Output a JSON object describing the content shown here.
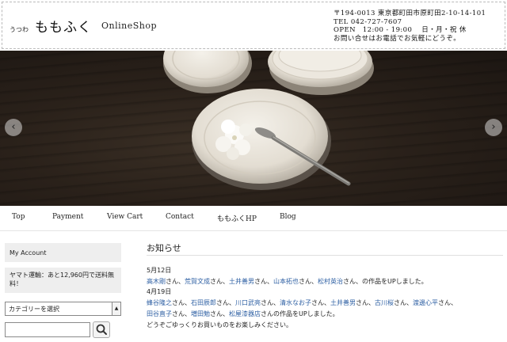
{
  "header": {
    "logo_small": "うつわ",
    "logo_main": "ももふく",
    "shop_title": "OnlineShop",
    "info_lines": [
      "〒194-0013 東京都町田市原町田2-10-14-101",
      "TEL 042-727-7607",
      "OPEN　12:00 - 19:00　 日・月・祝 休",
      "お問い合せはお電話でお気軽にどうぞ。"
    ]
  },
  "hero": {
    "prev_label": "‹",
    "next_label": "›"
  },
  "nav": {
    "items": [
      "Top",
      "Payment",
      "View Cart",
      "Contact",
      "ももふくHP",
      "Blog"
    ]
  },
  "sidebar": {
    "my_account": "My Account",
    "shipping_text": "ヤマト運輸：あと12,960円で送料無料！",
    "category_placeholder": "カテゴリーを選択"
  },
  "main": {
    "title": "お知らせ",
    "entries": [
      {
        "date": "5月12日",
        "artists": [
          "高木剛",
          "荒賀文成",
          "土井善男",
          "山本拓也",
          "松村英治"
        ],
        "suffix": "の作品をUPしました。"
      },
      {
        "date": "4月19日",
        "artists_line1": [
          "蜂谷隆之",
          "石田辰郎",
          "川口武亮",
          "清水なお子",
          "土井善男",
          "古川桜",
          "渡邊心平"
        ],
        "artists_line2": [
          "田谷直子",
          "増田勉",
          "松屋漆器店"
        ],
        "suffix": "の作品をUPしました。",
        "closing": "どうぞごゆっくりお買いものをお楽しみください。"
      }
    ],
    "san": "さん",
    "comma": "、"
  },
  "colors": {
    "link": "#2d5fa3",
    "sidebar_box": "#eeeeee"
  }
}
